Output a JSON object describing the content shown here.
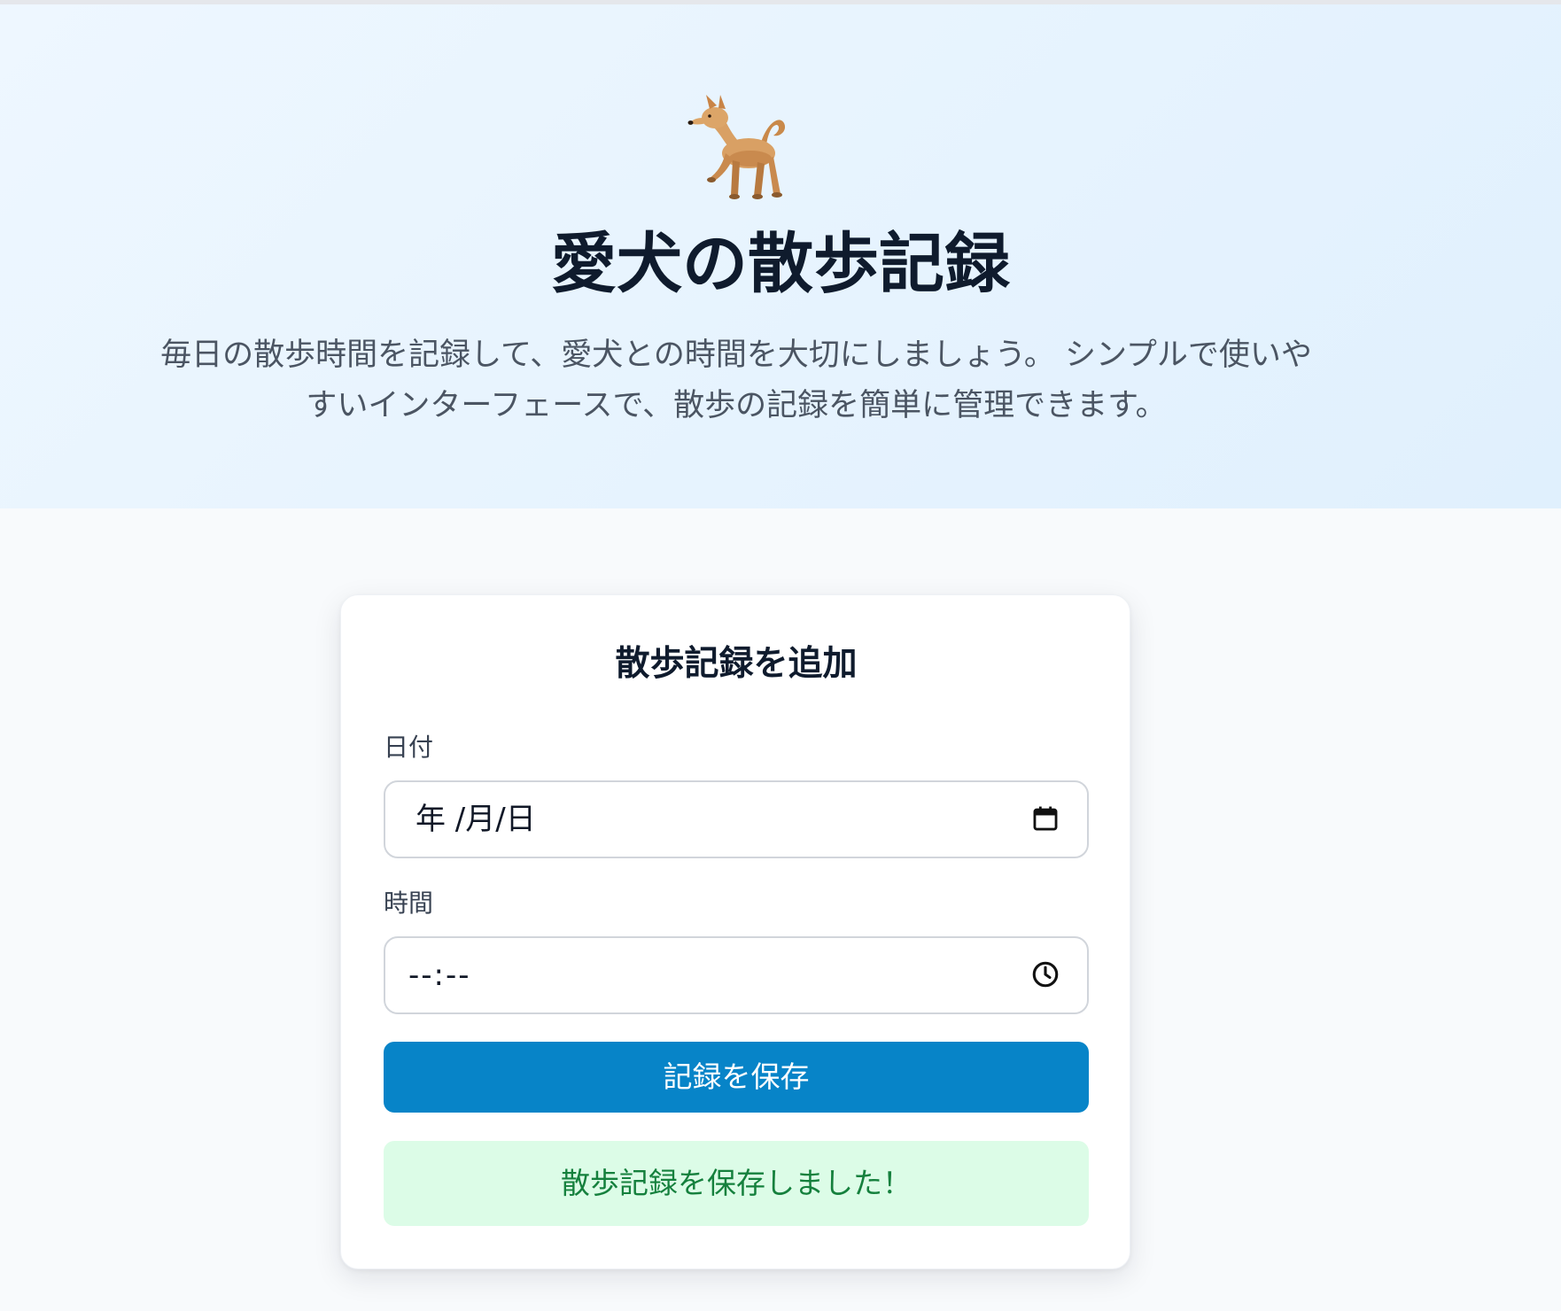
{
  "hero": {
    "icon": "dog-icon",
    "title": "愛犬の散歩記録",
    "description_line1": "毎日の散歩時間を記録して、愛犬との時間を大切にしましょう。 シンプルで使いや",
    "description_line2": "すいインターフェースで、散歩の記録を簡単に管理できます。"
  },
  "form": {
    "title": "散歩記録を追加",
    "date_label": "日付",
    "date_value": "年 /月/日",
    "date_icon": "calendar-icon",
    "time_label": "時間",
    "time_value": "--:--",
    "time_icon": "clock-icon",
    "submit_label": "記録を保存",
    "success_message": "散歩記録を保存しました！"
  },
  "colors": {
    "accent": "#0784c8",
    "success_background": "#dcfce7",
    "success_text": "#15803d",
    "hero_background": "#e8f4fe"
  }
}
